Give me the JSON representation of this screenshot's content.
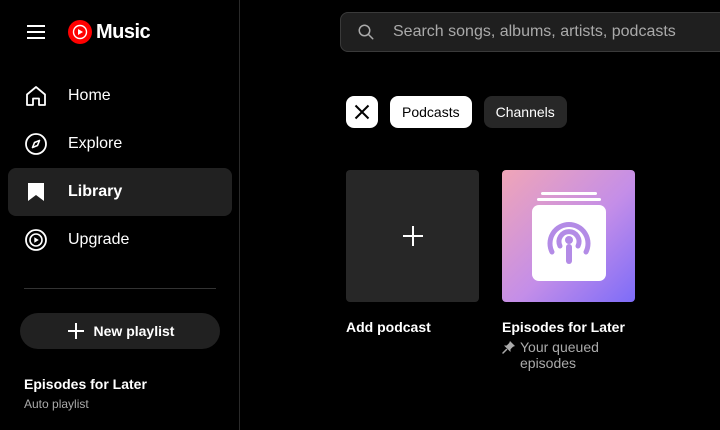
{
  "app": {
    "logo_text": "Music",
    "brand_color": "#ff0000"
  },
  "sidebar": {
    "items": [
      {
        "label": "Home",
        "icon": "home-icon",
        "active": false
      },
      {
        "label": "Explore",
        "icon": "compass-icon",
        "active": false
      },
      {
        "label": "Library",
        "icon": "bookmark-icon",
        "active": true
      },
      {
        "label": "Upgrade",
        "icon": "upgrade-icon",
        "active": false
      }
    ],
    "new_playlist_label": "New playlist",
    "playlist": {
      "title": "Episodes for Later",
      "subtitle": "Auto playlist"
    }
  },
  "search": {
    "placeholder": "Search songs, albums, artists, podcasts",
    "value": ""
  },
  "filters": {
    "clear_icon": "close-icon",
    "chips": [
      {
        "label": "Podcasts",
        "selected": true
      },
      {
        "label": "Channels",
        "selected": false
      }
    ]
  },
  "cards": {
    "add": {
      "title": "Add podcast",
      "icon": "plus-icon"
    },
    "later": {
      "title": "Episodes for Later",
      "subtitle": "Your queued episodes",
      "icon": "podcast-stack-icon",
      "pin_icon": "pin-icon"
    }
  }
}
